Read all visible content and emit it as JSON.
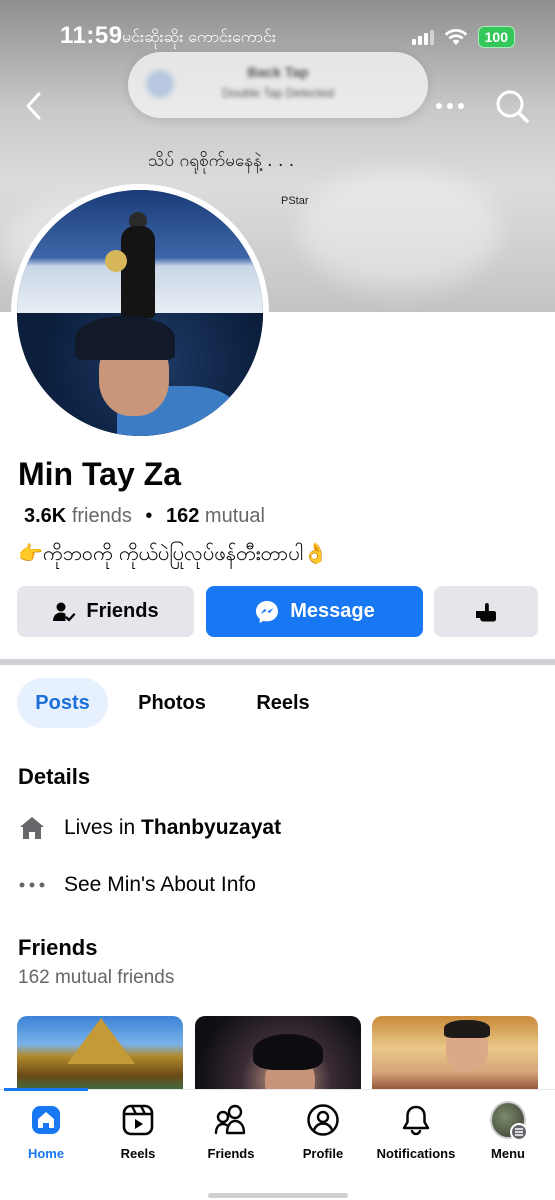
{
  "status_bar": {
    "time": "11:59",
    "battery": "100",
    "signal_icon": "cellular-signal-icon",
    "wifi_icon": "wifi-icon"
  },
  "notification_banner": {
    "title": "Back Tap",
    "subtitle": "Double Tap Detected"
  },
  "cover": {
    "line_top": "မင်းဆိုးဆိုး ကောင်းကောင်း",
    "line_bottom": "သိပ် ဂရုစိုက်မနေနဲ့ . . .",
    "credit": "PStar"
  },
  "header": {
    "back_icon": "back-arrow-icon",
    "more_icon": "more-dots-icon",
    "search_icon": "search-icon"
  },
  "profile": {
    "name": "Min Tay Za",
    "friends_count": "3.6K",
    "friends_label": "friends",
    "separator": "•",
    "mutual_count": "162",
    "mutual_label": "mutual",
    "bio": "👉ကိုဘဝကို ကိုယ်ပဲပြုလုပ်ဖန်တီးတာပါ👌"
  },
  "actions": {
    "friends_label": "Friends",
    "message_label": "Message",
    "more_icon": "poke-hand-icon"
  },
  "tabs": [
    {
      "label": "Posts",
      "active": true
    },
    {
      "label": "Photos",
      "active": false
    },
    {
      "label": "Reels",
      "active": false
    }
  ],
  "details": {
    "title": "Details",
    "lives_prefix": "Lives in ",
    "lives_city": "Thanbyuzayat",
    "about_link": "See Min's About Info"
  },
  "friends_section": {
    "title": "Friends",
    "subtitle": "162 mutual friends"
  },
  "bottom_nav": {
    "items": [
      {
        "label": "Home",
        "icon": "home-icon",
        "active": true
      },
      {
        "label": "Reels",
        "icon": "reels-icon",
        "active": false
      },
      {
        "label": "Friends",
        "icon": "friends-icon",
        "active": false
      },
      {
        "label": "Profile",
        "icon": "profile-icon",
        "active": false
      },
      {
        "label": "Notifications",
        "icon": "bell-icon",
        "active": false
      },
      {
        "label": "Menu",
        "icon": "menu-avatar-icon",
        "active": false
      }
    ]
  },
  "colors": {
    "accent": "#1877f2",
    "secondary_button": "#e4e6eb",
    "muted_text": "#65676b",
    "tab_active_bg": "#e7f0fd"
  }
}
